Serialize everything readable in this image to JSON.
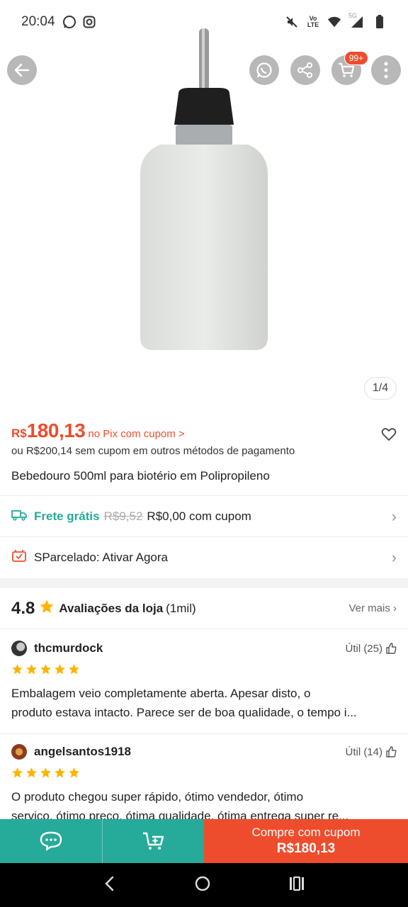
{
  "status_bar": {
    "time": "20:04",
    "left_icons": [
      "whatsapp-icon",
      "instagram-icon"
    ],
    "right_icons": [
      "mute-icon",
      "volte-icon",
      "wifi-icon",
      "5g-signal-icon",
      "battery-icon"
    ],
    "network_label": "5G"
  },
  "gallery": {
    "counter": "1/4",
    "cart_badge": "99+"
  },
  "price": {
    "currency": "R$",
    "value": "180,13",
    "pix_link": "no Pix com cupom >",
    "alt_line": "ou R$200,14 sem cupom em outros métodos de pagamento"
  },
  "product": {
    "title": "Bebedouro 500ml para biotério em Polipropileno"
  },
  "shipping": {
    "free_label": "Frete grátis",
    "old_price": "R$9,52",
    "new_price": "R$0,00 com cupom"
  },
  "installments": {
    "label": "SParcelado: Ativar Agora"
  },
  "store_reviews": {
    "rating": "4.8",
    "title": "Avaliações da loja",
    "count": "(1mil)",
    "see_more": "Ver mais"
  },
  "reviews": [
    {
      "user": "thcmurdock",
      "useful": "Útil (25)",
      "stars": 5,
      "text_line1": "Embalagem veio completamente aberta. Apesar disto, o",
      "text_line2": "produto estava intacto. Parece ser de boa qualidade, o tempo i..."
    },
    {
      "user": "angelsantos1918",
      "useful": "Útil (14)",
      "stars": 5,
      "text_line1": "O produto chegou super rápido, ótimo vendedor, ótimo",
      "text_line2": "serviço, ótimo preço, ótima qualidade, ótima entrega super re..."
    }
  ],
  "bottom_bar": {
    "buy_label": "Compre com cupom",
    "buy_price": "R$180,13"
  },
  "colors": {
    "brand_orange": "#ee4d2d",
    "teal": "#26aa99",
    "star": "#ffb400"
  }
}
